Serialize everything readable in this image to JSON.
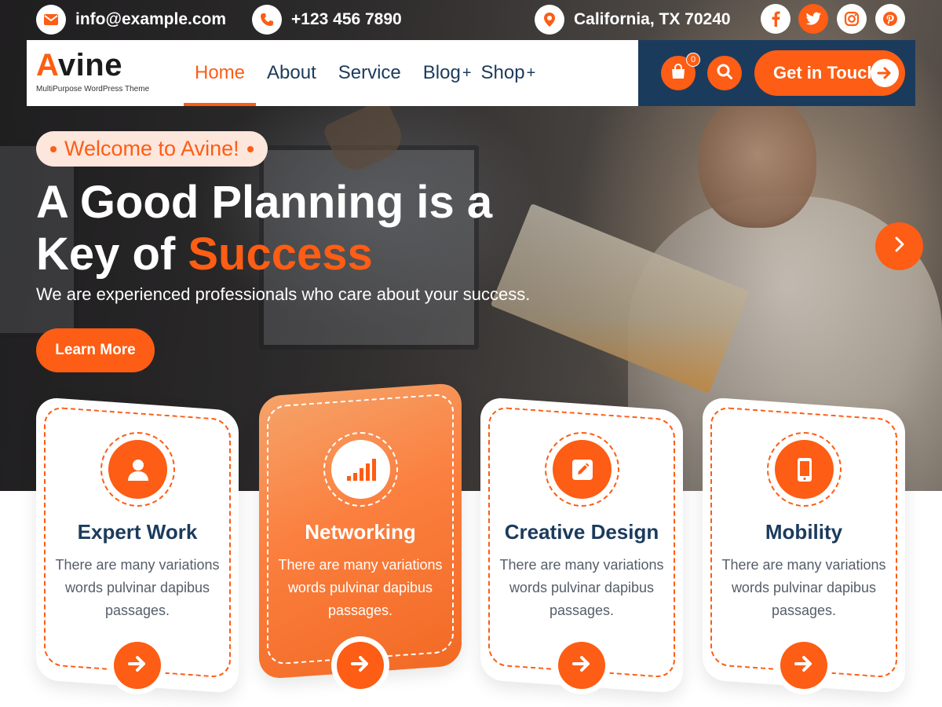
{
  "theme": {
    "accent": "#fd5d14",
    "navy": "#1b3b5d",
    "white": "#ffffff"
  },
  "topbar": {
    "email": {
      "icon": "envelope-icon",
      "text": "info@example.com"
    },
    "phone": {
      "icon": "phone-icon",
      "text": "+123 456 7890"
    },
    "location": {
      "icon": "map-pin-icon",
      "text": "California, TX 70240"
    },
    "social": [
      "facebook-icon",
      "twitter-icon",
      "instagram-icon",
      "pinterest-icon"
    ]
  },
  "brand": {
    "first_letter": "A",
    "rest": "vine",
    "tagline": "MultiPurpose WordPress Theme"
  },
  "nav": {
    "items": [
      {
        "label": "Home",
        "active": true,
        "has_sub": false
      },
      {
        "label": "About",
        "active": false,
        "has_sub": false
      },
      {
        "label": "Service",
        "active": false,
        "has_sub": false
      },
      {
        "label": "Blog",
        "active": false,
        "has_sub": true
      },
      {
        "label": "Shop",
        "active": false,
        "has_sub": true
      }
    ],
    "sub_marker": "+",
    "cart_count": "0",
    "cta_label": "Get in Touch"
  },
  "hero": {
    "badge": "Welcome to Avine!",
    "title_line1": "A Good Planning is a",
    "title_line2_prefix": "Key of ",
    "title_line2_accent": "Success",
    "subtitle": "We are experienced professionals who care about your success.",
    "button": "Learn More"
  },
  "services": [
    {
      "title": "Expert Work",
      "text": "There are many variations words pulvinar dapibus passages.",
      "icon": "user-icon",
      "featured": false
    },
    {
      "title": "Networking",
      "text": "There are many variations words pulvinar dapibus passages.",
      "icon": "signal-bars-icon",
      "featured": true
    },
    {
      "title": "Creative Design",
      "text": "There are many variations words pulvinar dapibus passages.",
      "icon": "pencil-square-icon",
      "featured": false
    },
    {
      "title": "Mobility",
      "text": "There are many variations words pulvinar dapibus passages.",
      "icon": "mobile-phone-icon",
      "featured": false
    }
  ]
}
